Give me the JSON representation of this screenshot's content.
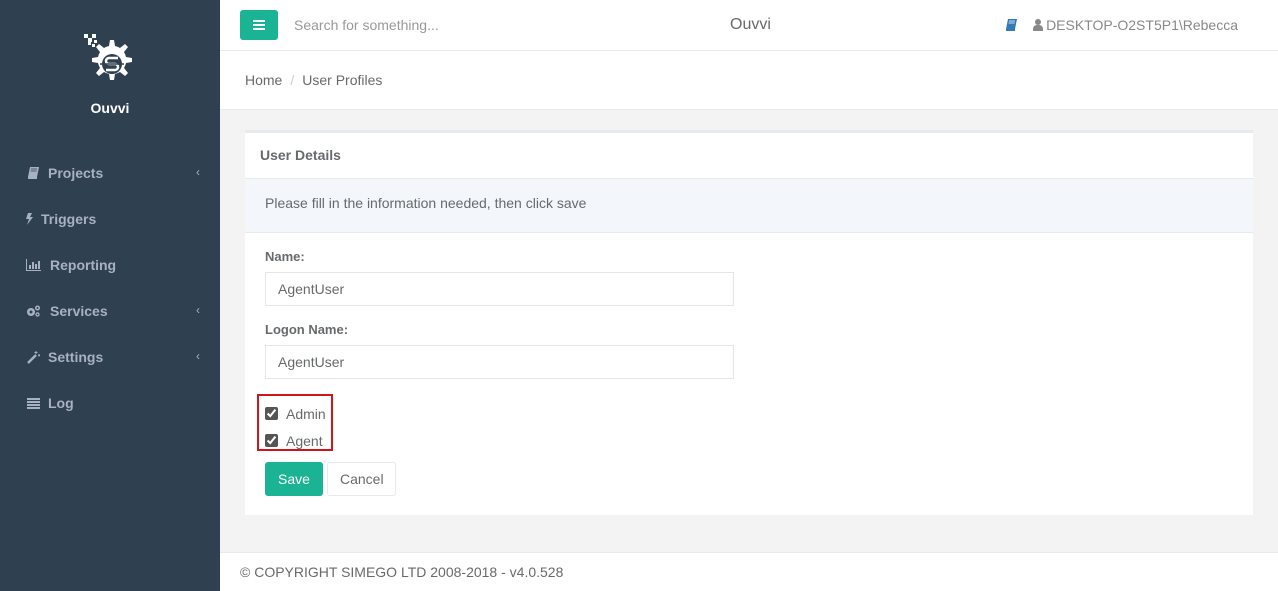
{
  "app": {
    "brand": "Ouvvi",
    "title": "Ouvvi"
  },
  "sidebar": {
    "logo_icon": "gear-s-logo-icon",
    "items": [
      {
        "label": "Projects",
        "icon": "book-icon",
        "has_submenu": true
      },
      {
        "label": "Triggers",
        "icon": "bolt-icon",
        "has_submenu": false
      },
      {
        "label": "Reporting",
        "icon": "bar-chart-icon",
        "has_submenu": false
      },
      {
        "label": "Services",
        "icon": "cogs-icon",
        "has_submenu": true
      },
      {
        "label": "Settings",
        "icon": "magic-wand-icon",
        "has_submenu": true
      },
      {
        "label": "Log",
        "icon": "list-icon",
        "has_submenu": false
      }
    ]
  },
  "topbar": {
    "menu_icon": "hamburger-icon",
    "search_placeholder": "Search for something...",
    "search_value": "",
    "help_icon": "book-icon",
    "user_icon": "user-icon",
    "user": "DESKTOP-O2ST5P1\\Rebecca"
  },
  "breadcrumb": {
    "items": [
      "Home",
      "User Profiles"
    ],
    "separator": "/"
  },
  "panel": {
    "title": "User Details",
    "info": "Please fill in the information needed, then click save",
    "fields": [
      {
        "label": "Name:",
        "value": "AgentUser"
      },
      {
        "label": "Logon Name:",
        "value": "AgentUser"
      }
    ],
    "checkboxes": [
      {
        "label": "Admin",
        "checked": true
      },
      {
        "label": "Agent",
        "checked": true
      }
    ],
    "save_label": "Save",
    "cancel_label": "Cancel"
  },
  "footer": {
    "text": "© COPYRIGHT SIMEGO LTD 2008-2018 - v4.0.528"
  },
  "colors": {
    "sidebar": "#2f4050",
    "accent": "#1ab394",
    "highlight": "#d0161b",
    "help_icon": "#337ab7"
  }
}
